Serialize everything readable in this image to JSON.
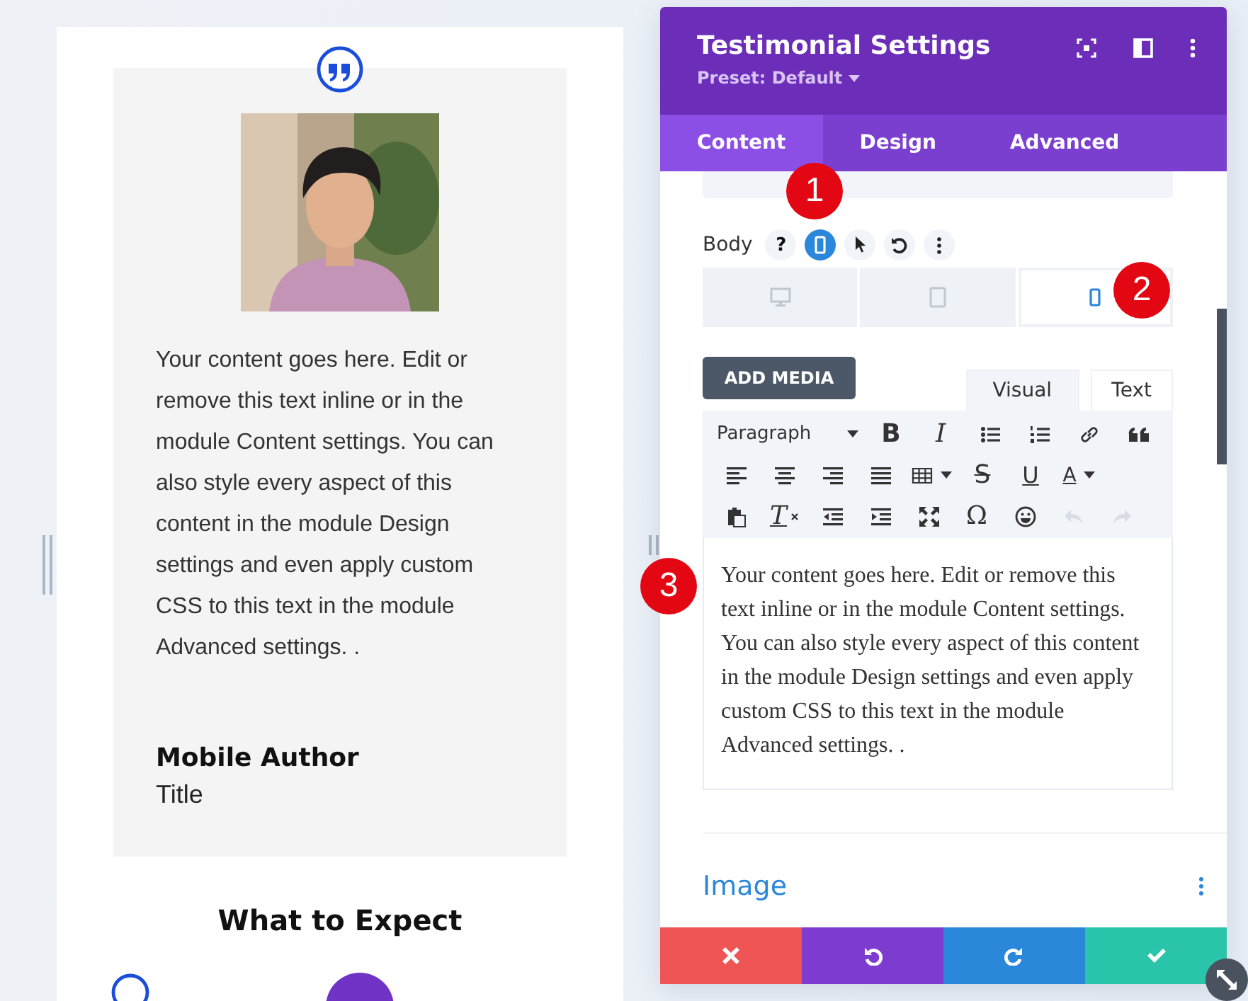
{
  "preview": {
    "body_text": "Your content goes here. Edit or remove this text inline or in the module Content settings. You can also style every aspect of this content in the module Design settings and even apply custom CSS to this text in the module Advanced settings. .",
    "author": "Mobile Author",
    "author_title": "Title",
    "section_heading": "What to Expect"
  },
  "panel": {
    "title": "Testimonial Settings",
    "preset": "Preset: Default",
    "tabs": [
      {
        "label": "Content",
        "selected": true
      },
      {
        "label": "Design",
        "selected": false
      },
      {
        "label": "Advanced",
        "selected": false
      }
    ],
    "body_label": "Body",
    "body_tools": [
      {
        "kind": "help",
        "label": "?",
        "selected": false
      },
      {
        "kind": "phone",
        "selected": true
      },
      {
        "kind": "pointer",
        "selected": false
      },
      {
        "kind": "reset",
        "selected": false
      },
      {
        "kind": "more",
        "selected": false
      }
    ],
    "devices": [
      {
        "kind": "desktop",
        "selected": false
      },
      {
        "kind": "tablet",
        "selected": false
      },
      {
        "kind": "phone",
        "selected": true
      }
    ],
    "add_media": "ADD MEDIA",
    "editor_tabs": [
      {
        "label": "Visual",
        "selected": true
      },
      {
        "label": "Text",
        "selected": false
      }
    ],
    "format": "Paragraph",
    "toolbar": [
      [
        {
          "kind": "bold",
          "label": "B",
          "disabled": false
        },
        {
          "kind": "italic",
          "label": "I",
          "disabled": false
        },
        {
          "kind": "bullets",
          "disabled": false
        },
        {
          "kind": "numbers",
          "disabled": false
        },
        {
          "kind": "link",
          "disabled": false
        },
        {
          "kind": "quote",
          "disabled": false
        }
      ],
      [
        {
          "kind": "align-left",
          "disabled": false
        },
        {
          "kind": "align-center",
          "disabled": false
        },
        {
          "kind": "align-right",
          "disabled": false
        },
        {
          "kind": "justify",
          "disabled": false
        },
        {
          "kind": "table",
          "disabled": false
        },
        {
          "kind": "strike",
          "label": "S",
          "disabled": false
        },
        {
          "kind": "underline",
          "label": "U",
          "disabled": false
        },
        {
          "kind": "color",
          "label": "A",
          "disabled": false
        }
      ],
      [
        {
          "kind": "paste",
          "disabled": false
        },
        {
          "kind": "clear",
          "label": "T",
          "disabled": false
        },
        {
          "kind": "outdent",
          "disabled": false
        },
        {
          "kind": "indent",
          "disabled": false
        },
        {
          "kind": "fullscreen",
          "disabled": false
        },
        {
          "kind": "symbol",
          "label": "Ω",
          "disabled": false
        },
        {
          "kind": "emoji",
          "disabled": false
        },
        {
          "kind": "undo",
          "disabled": true
        },
        {
          "kind": "redo",
          "disabled": true
        }
      ]
    ],
    "editor_text": "Your content goes here. Edit or remove this text inline or in the module Content settings. You can also style every aspect of this content in the module Design settings and even apply custom CSS to this text in the module Advanced settings. .",
    "section": "Image",
    "actions": [
      {
        "kind": "cancel"
      },
      {
        "kind": "undo"
      },
      {
        "kind": "redo"
      },
      {
        "kind": "save"
      }
    ]
  },
  "markers": [
    {
      "label": "1"
    },
    {
      "label": "2"
    },
    {
      "label": "3"
    }
  ]
}
